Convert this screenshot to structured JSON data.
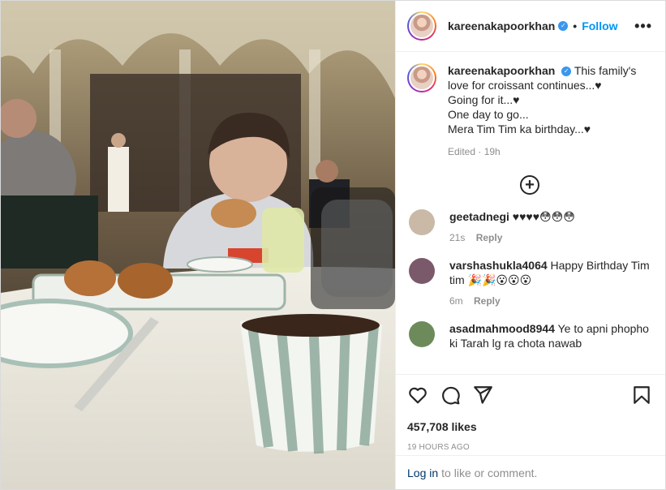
{
  "photo": {
    "icon": "breakfast-photo",
    "alt_colors": [
      "#3a332b",
      "#e9e6dc",
      "#8b8f86"
    ]
  },
  "header": {
    "username": "kareenakapoorkhan",
    "verified_icon": "✓",
    "dot": "•",
    "follow_label": "Follow",
    "more_icon": "•••"
  },
  "caption": {
    "username": "kareenakapoorkhan",
    "lines": [
      "This family's",
      "love for croissant continues...♥",
      "Going for it...♥",
      "One day to go...",
      "Mera Tim Tim ka birthday...♥"
    ],
    "line0_full": "This family's",
    "meta": "Edited · 19h"
  },
  "load_more_icon": "+",
  "comments": [
    {
      "username": "geetadnegi",
      "text": "♥♥♥♥😳😳😳",
      "time": "21s",
      "reply": "Reply",
      "avatar_color": "#c9b9a6"
    },
    {
      "username": "varshashukla4064",
      "text": "Happy Birthday Tim tim 🎉🎉😮😮😮",
      "time": "6m",
      "reply": "Reply",
      "avatar_color": "#7a5a6a"
    },
    {
      "username": "asadmahmood8944",
      "text": "Ye to apni phopho ki Tarah lg ra chota nawab",
      "time": "",
      "reply": "",
      "avatar_color": "#6d8b5a"
    }
  ],
  "actions": {
    "like_icon": "heart-icon",
    "comment_icon": "comment-icon",
    "share_icon": "share-icon",
    "save_icon": "bookmark-icon",
    "likes": "457,708 likes",
    "timestamp": "19 HOURS AGO"
  },
  "login": {
    "link": "Log in",
    "rest": "to like or comment."
  }
}
